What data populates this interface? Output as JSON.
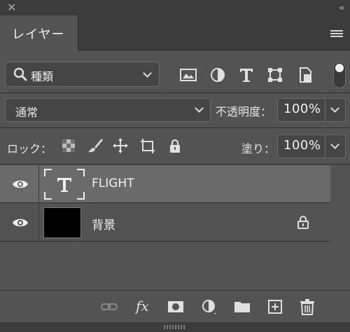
{
  "panel": {
    "tab_label": "レイヤー",
    "close_icon": "close-icon",
    "collapse_icon": "collapse-double-chevron-icon",
    "menu_icon": "hamburger-menu-icon"
  },
  "filter": {
    "selected": "種類",
    "icons": [
      "image-filter-icon",
      "adjustment-filter-icon",
      "type-filter-icon",
      "shape-filter-icon",
      "smart-object-filter-icon"
    ],
    "toggle_on": true
  },
  "blend": {
    "mode": "通常",
    "opacity_label": "不透明度：",
    "opacity_value": "100%"
  },
  "lock": {
    "label": "ロック：",
    "icons": [
      "lock-transparency-icon",
      "lock-pixels-brush-icon",
      "lock-position-move-icon",
      "lock-artboard-icon",
      "lock-all-icon"
    ],
    "fill_label": "塗り：",
    "fill_value": "100%"
  },
  "layers": [
    {
      "name": "FLIGHT",
      "type": "text",
      "visible": true,
      "selected": true,
      "locked": false
    },
    {
      "name": "背景",
      "type": "pixel",
      "visible": true,
      "selected": false,
      "locked": true
    }
  ],
  "bottom": {
    "icons": [
      "link-layers-icon",
      "fx-effects-icon",
      "add-mask-icon",
      "adjustment-layer-icon",
      "new-group-folder-icon",
      "new-layer-icon",
      "trash-icon"
    ],
    "fx_label": "fx"
  },
  "colors": {
    "panel_bg": "#535353",
    "header_bg": "#3c3c3c",
    "selected_row": "#6a6a6a"
  }
}
